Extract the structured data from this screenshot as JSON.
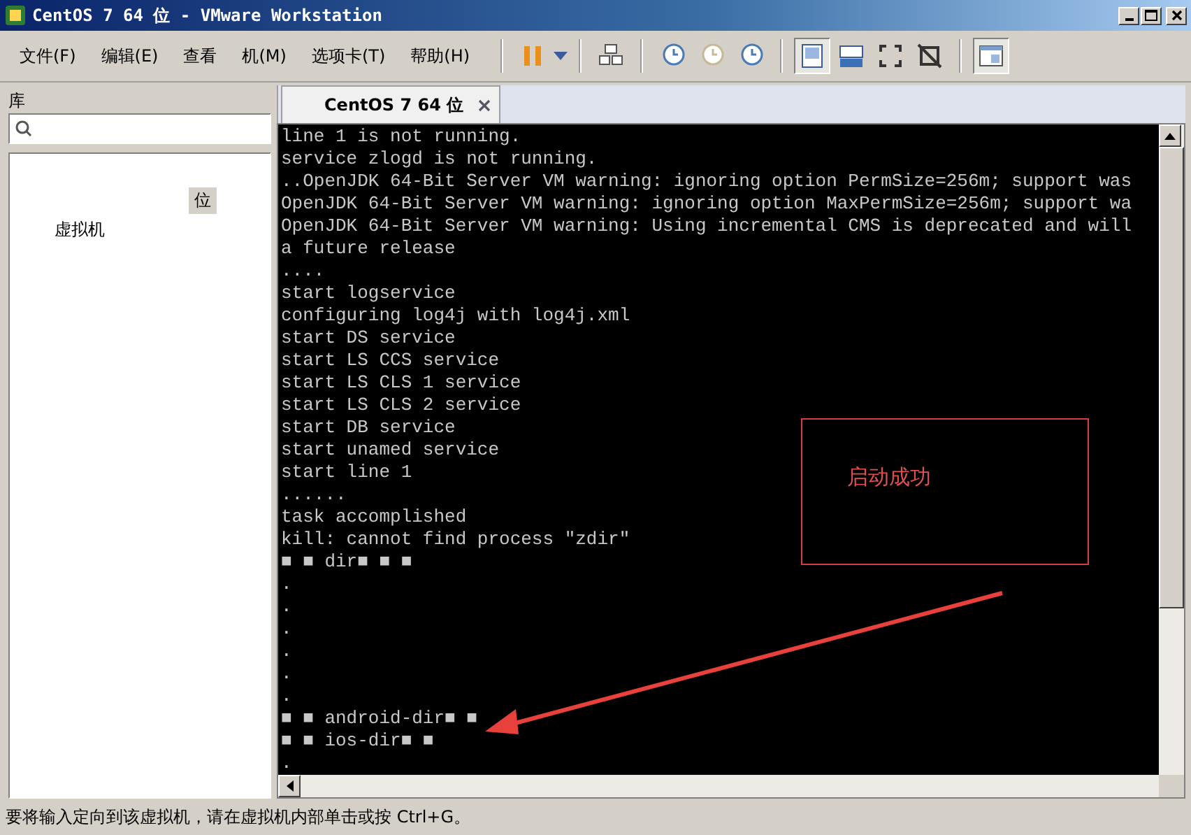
{
  "window": {
    "title": "CentOS 7 64 位 - VMware Workstation"
  },
  "menu": [
    {
      "label": "文件(F)"
    },
    {
      "label": "编辑(E)"
    },
    {
      "label": "查看"
    },
    {
      "label": "机(M)"
    },
    {
      "label": "选项卡(T)"
    },
    {
      "label": "帮助(H)"
    }
  ],
  "toolbar": {
    "view_buttons": [
      {
        "selected": true
      },
      {
        "selected": false
      },
      {
        "selected": false
      },
      {
        "selected": false
      }
    ]
  },
  "sidebar": {
    "title": "库",
    "tree": [
      {
        "label": "位",
        "selected": true
      },
      {
        "label": "虚拟机",
        "selected": false
      }
    ]
  },
  "tabs": [
    {
      "label": "CentOS 7 64 位",
      "selected": true
    }
  ],
  "console": {
    "lines": [
      "line 1 is not running.",
      "service zlogd is not running.",
      "..OpenJDK 64-Bit Server VM warning: ignoring option PermSize=256m; support was",
      "OpenJDK 64-Bit Server VM warning: ignoring option MaxPermSize=256m; support wa",
      "OpenJDK 64-Bit Server VM warning: Using incremental CMS is deprecated and will",
      "a future release",
      "....",
      "start logservice",
      "configuring log4j with log4j.xml",
      "start DS service",
      "start LS CCS service",
      "start LS CLS 1 service",
      "start LS CLS 2 service",
      "start DB service",
      "start unamed service",
      "start line 1",
      "......",
      "task accomplished",
      "kill: cannot find process \"zdir\"",
      "■ ■ dir■ ■ ■",
      ".",
      ".",
      ".",
      ".",
      ".",
      ".",
      "■ ■ android-dir■ ■",
      "■ ■ ios-dir■ ■",
      "."
    ],
    "annotation": {
      "text": "启动成功"
    }
  },
  "status_bar": {
    "text": "要将输入定向到该虚拟机，请在虚拟机内部单击或按 Ctrl+G。"
  }
}
